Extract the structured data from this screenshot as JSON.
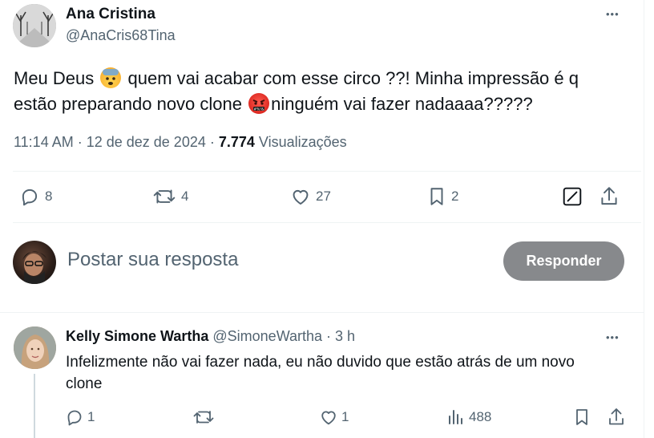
{
  "tweet": {
    "name": "Ana Cristina",
    "handle": "@AnaCris68Tina",
    "more": "•••",
    "text_part1": "Meu Deus ",
    "text_part2": " quem vai acabar com esse circo ??! Minha impressão é q",
    "text_line2_part1": "estão preparando novo clone ",
    "text_line2_part2": "ninguém vai fazer nadaaaa?????",
    "emoji1": "anxious-face-with-sweat",
    "emoji2": "face-with-symbols-on-mouth",
    "timestamp": "11:14 AM · 12 de dez de 2024 · ",
    "views_count": "7.774",
    "views_label": " Visualizações",
    "replies": "8",
    "retweets": "4",
    "likes": "27",
    "bookmarks": "2"
  },
  "composer": {
    "placeholder": "Postar sua resposta",
    "button": "Responder"
  },
  "reply": {
    "name": "Kelly Simone Wartha",
    "handle": "@SimoneWartha · 3 h",
    "more": "•••",
    "text_line1": "Infelizmente não vai fazer nada, eu não duvido que estão atrás de um novo",
    "text_line2": "clone",
    "replies": "1",
    "retweets": "",
    "likes": "1",
    "views": "488"
  },
  "colors": {
    "text": "#0f1419",
    "muted": "#536471",
    "divider": "#eff3f4",
    "button_bg": "#87898c",
    "thread_line": "#cfd9de"
  }
}
